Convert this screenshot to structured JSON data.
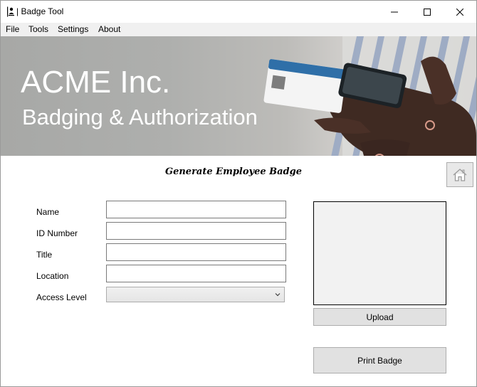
{
  "window": {
    "title": "Badge Tool",
    "controls": {
      "minimize_icon": "minimize-icon",
      "maximize_icon": "maximize-icon",
      "close_icon": "close-icon"
    }
  },
  "menu": {
    "items": [
      {
        "label": "File"
      },
      {
        "label": "Tools"
      },
      {
        "label": "Settings"
      },
      {
        "label": "About"
      }
    ]
  },
  "banner": {
    "title": "ACME Inc.",
    "subtitle": "Badging & Authorization"
  },
  "form": {
    "heading": "Generate Employee Badge",
    "fields": [
      {
        "label": "Name",
        "value": ""
      },
      {
        "label": "ID Number",
        "value": ""
      },
      {
        "label": "Title",
        "value": ""
      },
      {
        "label": "Location",
        "value": ""
      }
    ],
    "access_level": {
      "label": "Access Level",
      "selected": ""
    }
  },
  "photo": {
    "upload_label": "Upload"
  },
  "actions": {
    "print_label": "Print Badge",
    "home_icon": "home-icon"
  },
  "colors": {
    "menu_bg": "#f0f0f0",
    "button_bg": "#e1e1e1",
    "photo_bg": "#f2f2f2",
    "banner_text": "#ffffff"
  }
}
